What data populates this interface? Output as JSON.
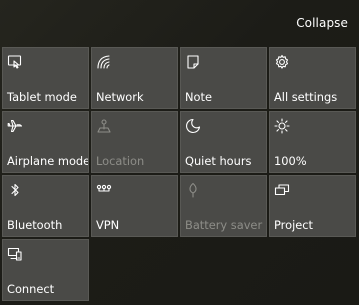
{
  "header": {
    "collapse_label": "Collapse"
  },
  "tiles": [
    {
      "label": "Tablet mode",
      "icon": "tablet-mode-icon",
      "enabled": true
    },
    {
      "label": "Network",
      "icon": "network-icon",
      "enabled": true
    },
    {
      "label": "Note",
      "icon": "note-icon",
      "enabled": true
    },
    {
      "label": "All settings",
      "icon": "gear-icon",
      "enabled": true
    },
    {
      "label": "Airplane mode",
      "icon": "airplane-icon",
      "enabled": true
    },
    {
      "label": "Location",
      "icon": "location-icon",
      "enabled": false
    },
    {
      "label": "Quiet hours",
      "icon": "moon-icon",
      "enabled": true
    },
    {
      "label": "100%",
      "icon": "brightness-icon",
      "enabled": true
    },
    {
      "label": "Bluetooth",
      "icon": "bluetooth-icon",
      "enabled": true
    },
    {
      "label": "VPN",
      "icon": "vpn-icon",
      "enabled": true
    },
    {
      "label": "Battery saver",
      "icon": "battery-saver-icon",
      "enabled": false
    },
    {
      "label": "Project",
      "icon": "project-icon",
      "enabled": true
    },
    {
      "label": "Connect",
      "icon": "connect-icon",
      "enabled": true
    }
  ],
  "colors": {
    "tile_background": "#4a4a47",
    "panel_background": "#1f1f19",
    "disabled_text": "#8d8d88"
  }
}
